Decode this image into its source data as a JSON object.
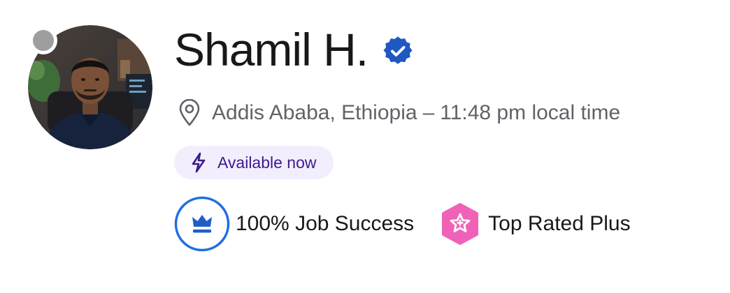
{
  "profile": {
    "name": "Shamil H.",
    "verified": true,
    "online_status": "offline",
    "location": "Addis Ababa, Ethiopia",
    "separator": "–",
    "local_time": "11:48 pm local time",
    "availability": "Available now",
    "job_success": "100% Job Success",
    "badge": "Top Rated Plus"
  },
  "icons": {
    "verified": "verified-check-icon",
    "location": "map-pin-icon",
    "availability": "lightning-bolt-icon",
    "job_success": "crown-icon",
    "badge": "star-badge-icon"
  },
  "colors": {
    "verified_blue": "#1f57c3",
    "jss_blue": "#1f6fe0",
    "availability_bg": "#f3eefd",
    "availability_text": "#3b1c8c",
    "top_rated_pink": "#f062b8",
    "status_gray": "#9e9e9e"
  }
}
